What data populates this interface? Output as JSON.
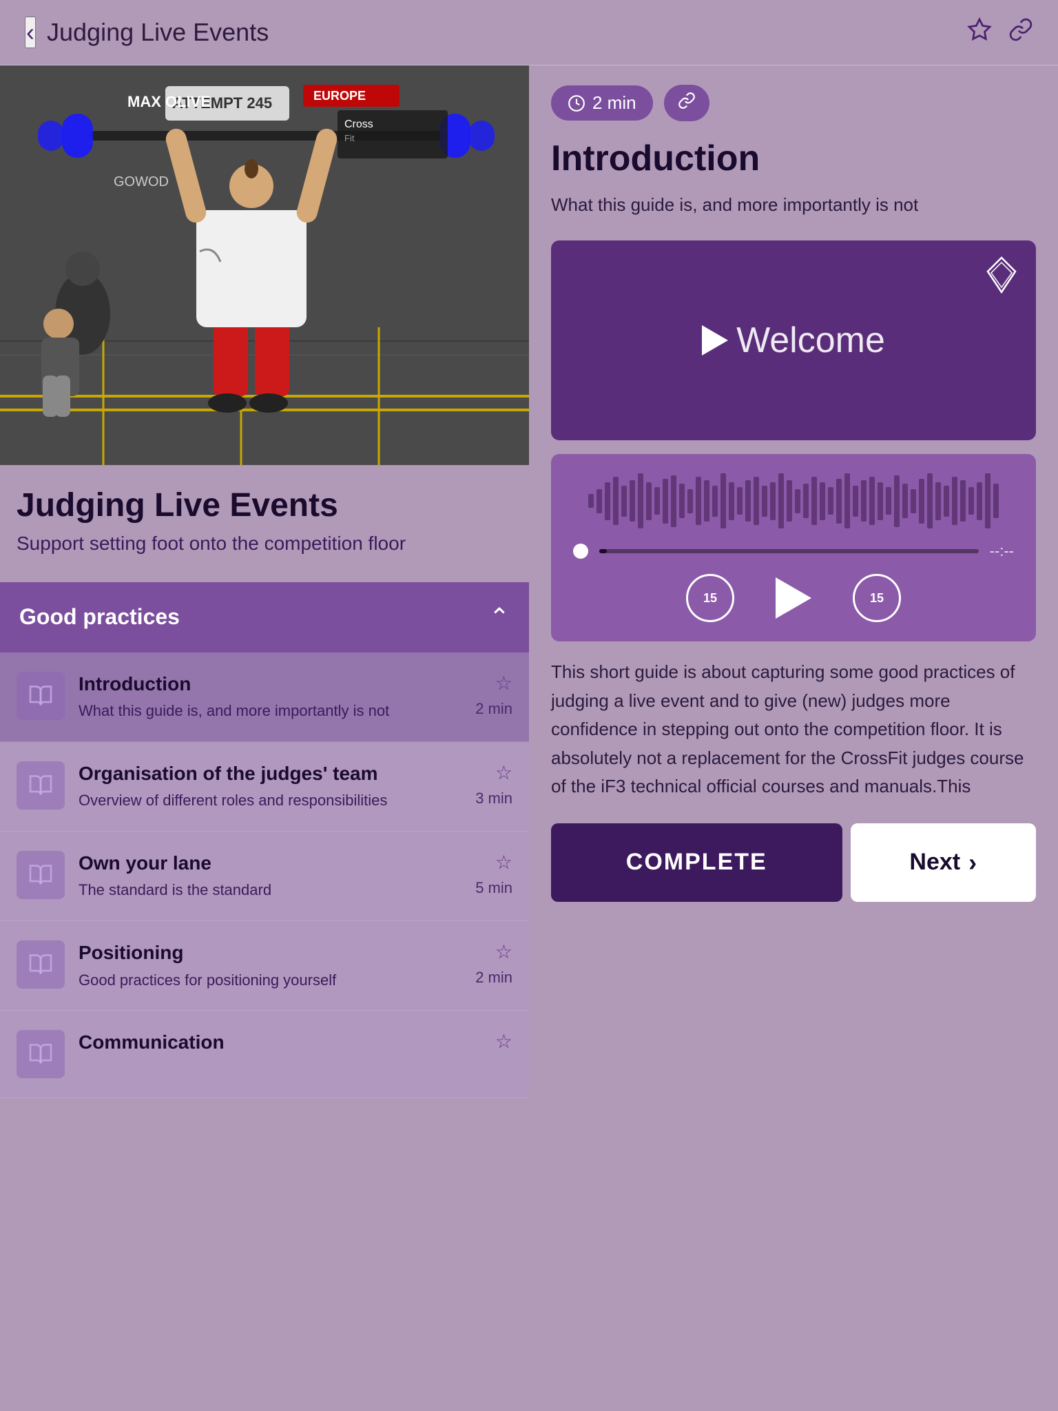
{
  "header": {
    "title": "Judging Live Events",
    "back_label": "‹",
    "bookmark_icon": "bookmark",
    "link_icon": "link"
  },
  "course": {
    "title": "Judging Live Events",
    "subtitle": "Support setting foot onto the competition floor"
  },
  "section": {
    "title": "Good practices",
    "expanded": true
  },
  "lessons": [
    {
      "id": "introduction",
      "name": "Introduction",
      "description": "What this guide is, and more importantly is not",
      "duration": "2 min",
      "active": true
    },
    {
      "id": "organisation",
      "name": "Organisation of the judges' team",
      "description": "Overview of different roles and responsibilities",
      "duration": "3 min",
      "active": false
    },
    {
      "id": "own-your-lane",
      "name": "Own your lane",
      "description": "The standard is the standard",
      "duration": "5 min",
      "active": false
    },
    {
      "id": "positioning",
      "name": "Positioning",
      "description": "Good practices for positioning yourself",
      "duration": "2 min",
      "active": false
    },
    {
      "id": "communication",
      "name": "Communication",
      "description": "",
      "duration": "",
      "active": false
    }
  ],
  "content": {
    "time_badge": "2 min",
    "title": "Introduction",
    "description": "What this guide is, and more importantly is not",
    "video_title": "Welcome",
    "body_text": "This short guide is about capturing some good practices of judging a live event and to give (new) judges more confidence in stepping out onto the competition floor. It is absolutely not a replacement for the CrossFit judges course of the iF3 technical official courses and manuals.This"
  },
  "audio_player": {
    "time_elapsed": "--:--",
    "progress_pct": 2
  },
  "buttons": {
    "complete": "COMPLETE",
    "next": "Next"
  },
  "waveform_heights": [
    20,
    35,
    55,
    70,
    45,
    60,
    80,
    55,
    40,
    65,
    75,
    50,
    35,
    70,
    60,
    45,
    80,
    55,
    40,
    60,
    70,
    45,
    55,
    80,
    60,
    35,
    50,
    70,
    55,
    40,
    65,
    80,
    45,
    60,
    70,
    55,
    40,
    75,
    50,
    35,
    65,
    80,
    55,
    45,
    70,
    60,
    40,
    55,
    80,
    50
  ]
}
